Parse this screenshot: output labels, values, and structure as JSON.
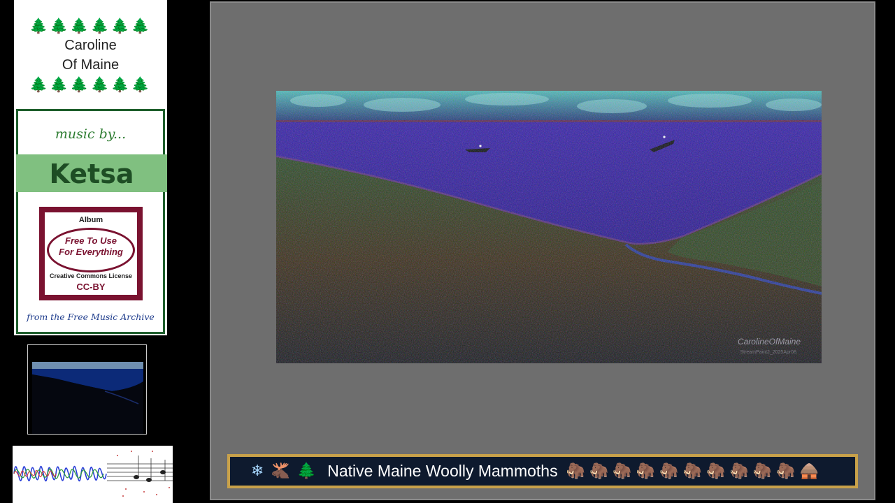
{
  "sidebar": {
    "tree_glyph": "🌲",
    "tree_count": 6,
    "station_line1": "Caroline",
    "station_line2": "Of Maine",
    "music_by": "music by...",
    "artist": "Ketsa",
    "album_label": "Album",
    "album_title_line1": "Free To Use",
    "album_title_line2": "For Everything",
    "license_name": "Creative Commons License",
    "license_code": "CC-BY",
    "source": "from the Free Music Archive"
  },
  "artwork": {
    "signature": "CarolineOfMaine",
    "caption": "StreamPaint2_2025Apr08"
  },
  "now_playing": {
    "icons": [
      "❄",
      "🫎",
      "🌲"
    ],
    "title": "Native Maine Woolly Mammoths",
    "mammoth_glyph": "🦣",
    "mammoth_count": 10,
    "end_icon": "🛖"
  },
  "colors": {
    "sidebar_accent": "#1e5e2c",
    "artist_band": "#80c080",
    "album_accent": "#7a1230",
    "banner_border": "#c8a14a",
    "banner_bg": "#0e1a2e",
    "stage_bg": "#6e6e6e"
  }
}
